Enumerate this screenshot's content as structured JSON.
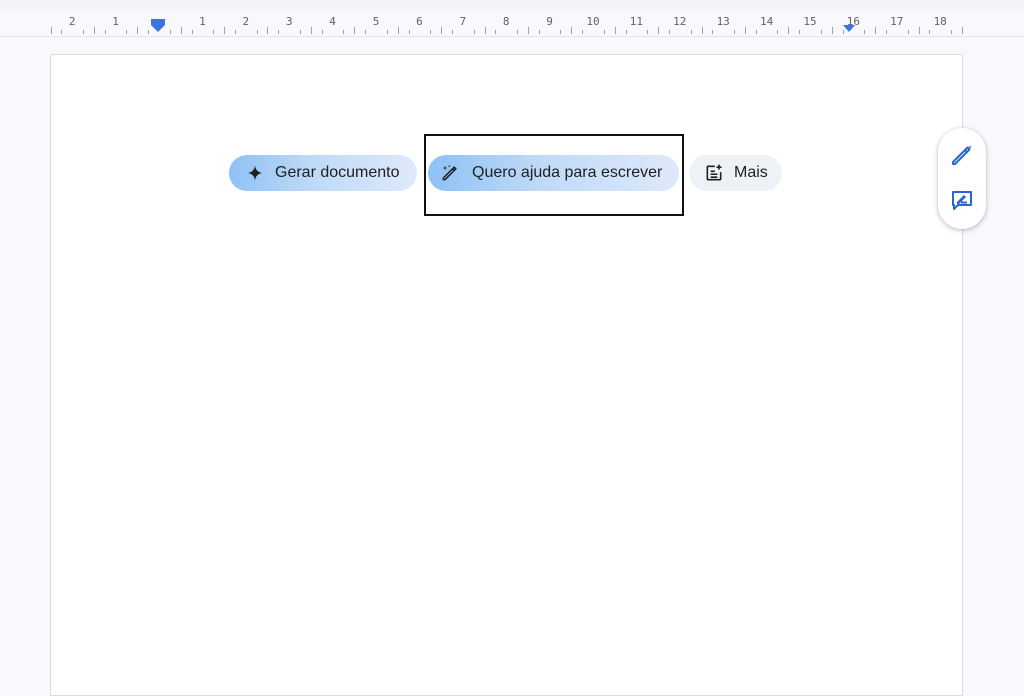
{
  "ruler": {
    "labels": [
      "2",
      "1",
      "1",
      "2",
      "3",
      "4",
      "5",
      "6",
      "7",
      "8",
      "9",
      "10",
      "11",
      "12",
      "13",
      "14",
      "15",
      "16",
      "17",
      "18"
    ]
  },
  "chips": {
    "generate_document": {
      "label": "Gerar documento",
      "icon": "sparkle-icon"
    },
    "help_me_write": {
      "label": "Quero ajuda para escrever",
      "icon": "magic-pen-icon"
    },
    "more": {
      "label": "Mais",
      "icon": "document-add-icon"
    }
  },
  "side_panel": {
    "buttons": [
      {
        "icon": "magic-pen-icon"
      },
      {
        "icon": "edit-comment-icon"
      }
    ]
  },
  "colors": {
    "accent": "#3b73e0",
    "chip_gradient_start": "#8ec1f5",
    "chip_gradient_end": "#dfe9fb",
    "chip_plain": "#eef1f6",
    "highlight": "#111111"
  }
}
